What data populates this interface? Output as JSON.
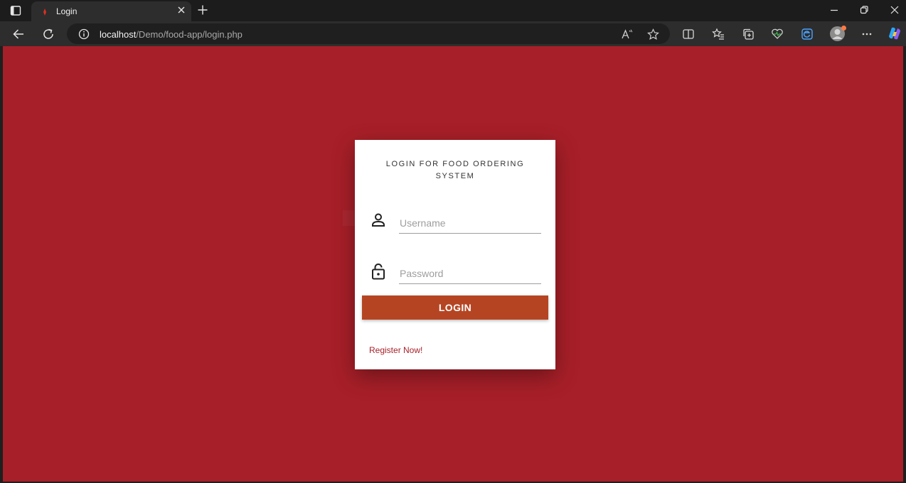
{
  "browser": {
    "tab_title": "Login",
    "url_host": "localhost",
    "url_path": "/Demo/food-app/login.php",
    "icons": [
      "tab-actions-icon",
      "favicon-icon",
      "close-tab-icon",
      "new-tab-icon",
      "minimize-icon",
      "restore-icon",
      "close-window-icon",
      "back-icon",
      "refresh-icon",
      "info-icon",
      "read-aloud-icon",
      "favorite-star-icon",
      "split-screen-icon",
      "favorites-icon",
      "collections-icon",
      "performance-icon",
      "edge-bar-icon",
      "profile-avatar",
      "more-icon",
      "copilot-icon"
    ]
  },
  "page": {
    "background_color": "#a71f28",
    "card": {
      "title": "LOGIN FOR FOOD ORDERING SYSTEM",
      "username_placeholder": "Username",
      "password_placeholder": "Password",
      "login_label": "LOGIN",
      "register_label": "Register Now!"
    },
    "colors": {
      "button": "#b54522",
      "link": "#a71f28"
    }
  }
}
